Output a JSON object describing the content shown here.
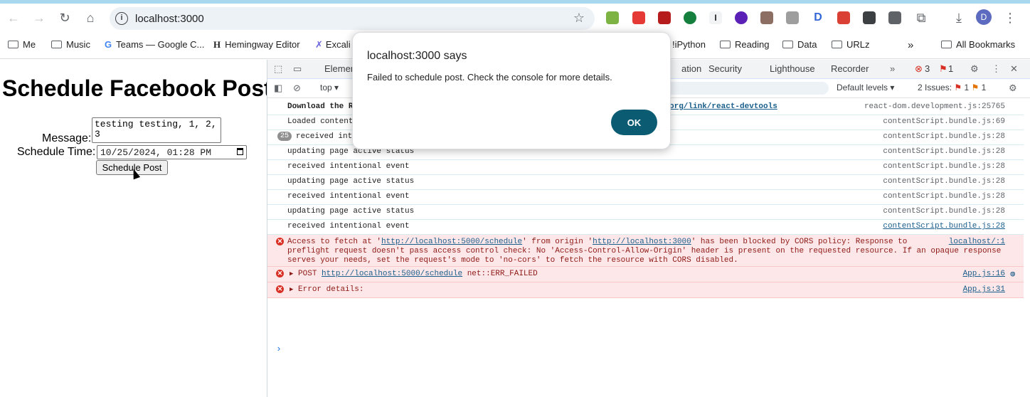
{
  "browser": {
    "url": "localhost:3000",
    "bookmarks": [
      {
        "label": "Me",
        "type": "folder"
      },
      {
        "label": "Music",
        "type": "folder"
      },
      {
        "label": "Teams — Google C...",
        "type": "link"
      },
      {
        "label": "Hemingway Editor",
        "type": "link"
      },
      {
        "label": "Excali",
        "type": "link"
      },
      {
        "label": "!iPython",
        "type": "link"
      },
      {
        "label": "Reading",
        "type": "folder"
      },
      {
        "label": "Data",
        "type": "folder"
      },
      {
        "label": "URLz",
        "type": "folder"
      }
    ],
    "all_bookmarks": "All Bookmarks",
    "profile_initial": "D"
  },
  "page": {
    "heading": "Schedule Facebook Post",
    "message_label": "Message:",
    "message_value": "testing testing, 1, 2, 3",
    "time_label": "Schedule Time:",
    "time_value": "10/25/2024, 01:28 PM",
    "submit_label": "Schedule Post"
  },
  "devtools": {
    "tabs": [
      "Elemen",
      "ation",
      "Security",
      "Lighthouse",
      "Recorder"
    ],
    "error_count": "3",
    "issue_flag_count": "1",
    "context": "top",
    "levels": "Default levels",
    "issues": "2 Issues:",
    "issues_errors": "1",
    "issues_warnings": "1",
    "logs": [
      {
        "text": "Download the R",
        "tail": "org/link/react-devtools",
        "source": "react-dom.development.js:25765",
        "bold": true
      },
      {
        "text": "Loaded content",
        "source": "contentScript.bundle.js:69"
      },
      {
        "text": "received inte",
        "source": "contentScript.bundle.js:28",
        "badge": "25"
      },
      {
        "text": "updating page active status",
        "source": "contentScript.bundle.js:28"
      },
      {
        "text": "received intentional event",
        "source": "contentScript.bundle.js:28"
      },
      {
        "text": "updating page active status",
        "source": "contentScript.bundle.js:28"
      },
      {
        "text": "received intentional event",
        "source": "contentScript.bundle.js:28"
      },
      {
        "text": "updating page active status",
        "source": "contentScript.bundle.js:28"
      },
      {
        "text": "received intentional event",
        "source": "contentScript.bundle.js:28"
      }
    ],
    "cors_error": {
      "p1": "Access to fetch at '",
      "url1": "http://localhost:5000/schedule",
      "p2": "' from origin '",
      "url2": "http://localhost:3000",
      "p3": "' has been blocked by CORS policy: Response to",
      "line2": "preflight request doesn't pass access control check: No 'Access-Control-Allow-Origin' header is present on the requested resource. If an opaque response",
      "line3": "serves your needs, set the request's mode to 'no-cors' to fetch the resource with CORS disabled.",
      "source": "localhost/:1"
    },
    "post_error": {
      "method": "POST",
      "url": "http://localhost:5000/schedule",
      "status": "net::ERR_FAILED",
      "source": "App.js:16"
    },
    "detail_error": {
      "text": "Error details:",
      "source": "App.js:31"
    }
  },
  "dialog": {
    "title": "localhost:3000 says",
    "message": "Failed to schedule post. Check the console for more details.",
    "ok_label": "OK"
  }
}
